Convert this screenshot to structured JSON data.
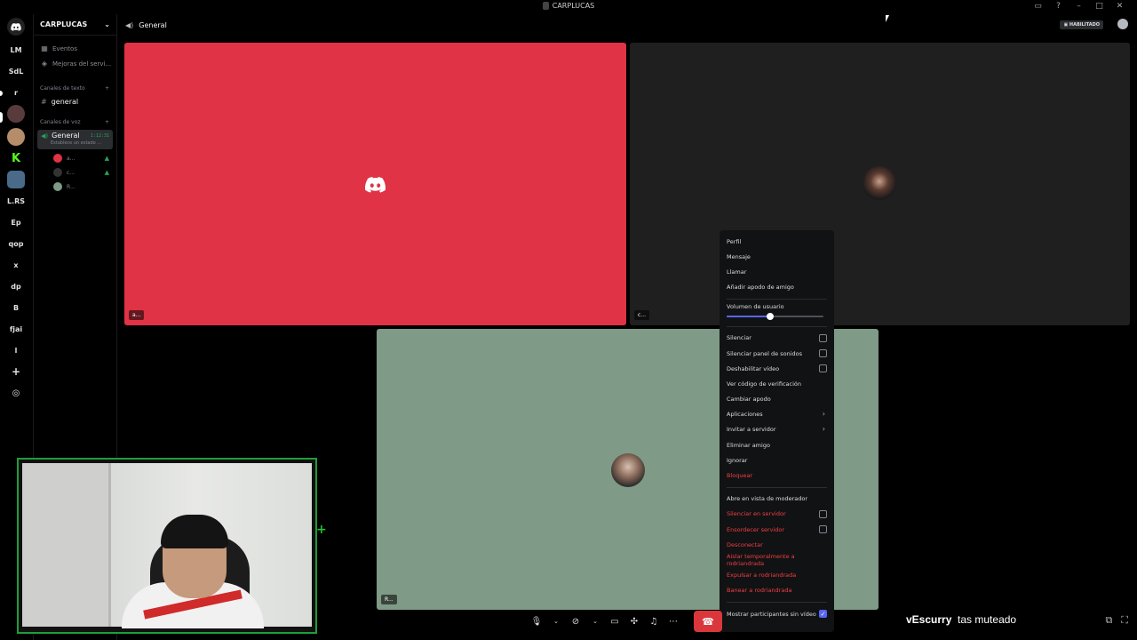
{
  "titlebar": {
    "title": "CARPLUCAS"
  },
  "rail": {
    "servers": [
      {
        "label": "LM",
        "name": "server-lm"
      },
      {
        "label": "SdL",
        "name": "server-sdl"
      },
      {
        "label": "r",
        "name": "server-r"
      },
      {
        "label": "",
        "name": "server-avatar-1"
      },
      {
        "label": "",
        "name": "server-avatar-2"
      },
      {
        "label": "",
        "name": "server-kick"
      },
      {
        "label": "",
        "name": "server-avatar-3"
      },
      {
        "label": "L.RS",
        "name": "server-lrs"
      },
      {
        "label": "Ep",
        "name": "server-ep"
      },
      {
        "label": "qop",
        "name": "server-qop"
      },
      {
        "label": "x",
        "name": "server-x"
      },
      {
        "label": "dp",
        "name": "server-dp"
      },
      {
        "label": "B",
        "name": "server-b"
      },
      {
        "label": "fjai",
        "name": "server-fjai"
      },
      {
        "label": "l",
        "name": "server-l"
      }
    ]
  },
  "sidebar": {
    "guild_name": "CARPLUCAS",
    "events": "Eventos",
    "boosts": "Mejoras del servi...",
    "text_category": "Canales de texto",
    "text_channel": "general",
    "voice_category": "Canales de voz",
    "voice_channel": "General",
    "voice_time": "1:12:31",
    "voice_status": "Establece un estado ...",
    "voice_users": [
      {
        "label": "a...",
        "color": "#e03345"
      },
      {
        "label": "c...",
        "color": "#2a2a2a"
      },
      {
        "label": "R...",
        "color": "#7f9a86"
      }
    ]
  },
  "header": {
    "channel": "General",
    "badge": "HABILITADO"
  },
  "tiles": {
    "t1_label": "a...",
    "t2_label": "c...",
    "t3_label": "R...",
    "colors": {
      "red": "#e03345",
      "dark": "#1f1f1f",
      "sage": "#7f9a86"
    }
  },
  "context_menu": {
    "items_top": [
      "Perfil",
      "Mensaje",
      "Llamar",
      "Añadir apodo de amigo"
    ],
    "volume_label": "Volumen de usuario",
    "volume_level": 0.45,
    "silenciar": "Silenciar",
    "silenciar_panel": "Silenciar panel de sonidos",
    "deshabilitar_video": "Deshabilitar vídeo",
    "ver_codigo": "Ver código de verificación",
    "cambiar_apodo": "Cambiar apodo",
    "aplicaciones": "Aplicaciones",
    "invitar": "Invitar a servidor",
    "eliminar": "Eliminar amigo",
    "ignorar": "Ignorar",
    "bloquear": "Bloquear",
    "moderador": "Abre en vista de moderador",
    "silenciar_servidor": "Silenciar en servidor",
    "ensordecer": "Ensordecer servidor",
    "desconectar": "Desconectar",
    "aislar": "Aislar temporalmente a rodriandrada",
    "expulsar": "Expulsar a rodriandrada",
    "banear": "Banear a rodriandrada",
    "mostrar": "Mostrar participantes sin vídeo"
  },
  "overlay": {
    "name": "vEscurry",
    "text": "tas muteado"
  },
  "accent": "#5865f2",
  "danger": "#f23f43"
}
